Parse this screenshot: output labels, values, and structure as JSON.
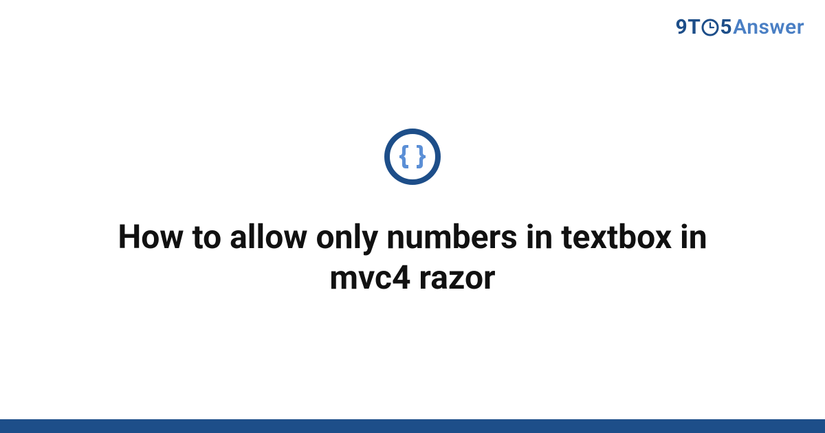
{
  "brand": {
    "nine": "9",
    "t": "T",
    "five": "5",
    "answer": "Answer"
  },
  "badge": {
    "name": "code-braces-icon"
  },
  "title": "How to allow only numbers in textbox in mvc4 razor",
  "colors": {
    "brand_dark": "#1d4e89",
    "brand_light": "#4a7fc4",
    "brace_blue": "#5b8fd6"
  }
}
